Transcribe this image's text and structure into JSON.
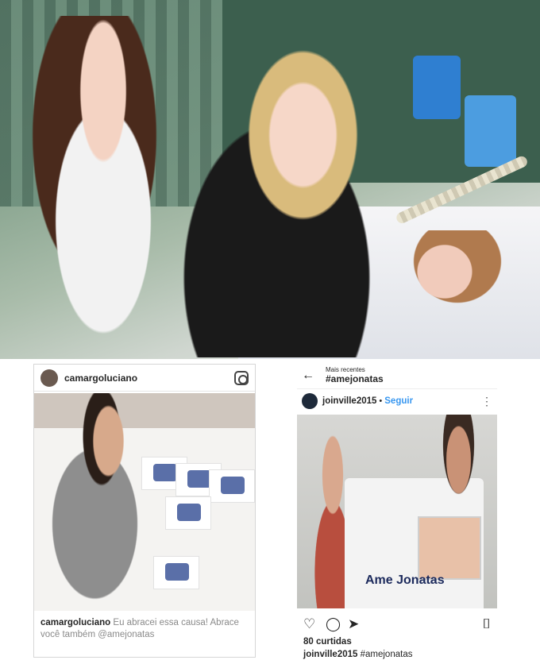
{
  "left_post": {
    "username": "camargoluciano",
    "caption_user": "camargoluciano",
    "caption_text": "Eu abracei essa causa! Abrace você também @amejonatas"
  },
  "right_post": {
    "header_small": "Mais recentes",
    "header_tag": "#amejonatas",
    "username": "joinville2015",
    "separator": "•",
    "follow_label": "Seguir",
    "more_label": "⋮",
    "poster_text": "Ame Jonatas",
    "likes": "80 curtidas",
    "caption_user": "joinville2015",
    "caption_tag": "#amejonatas"
  },
  "icons": {
    "back": "←",
    "heart": "♡",
    "comment": "◯",
    "share": "➤",
    "bookmark": "⌷"
  }
}
